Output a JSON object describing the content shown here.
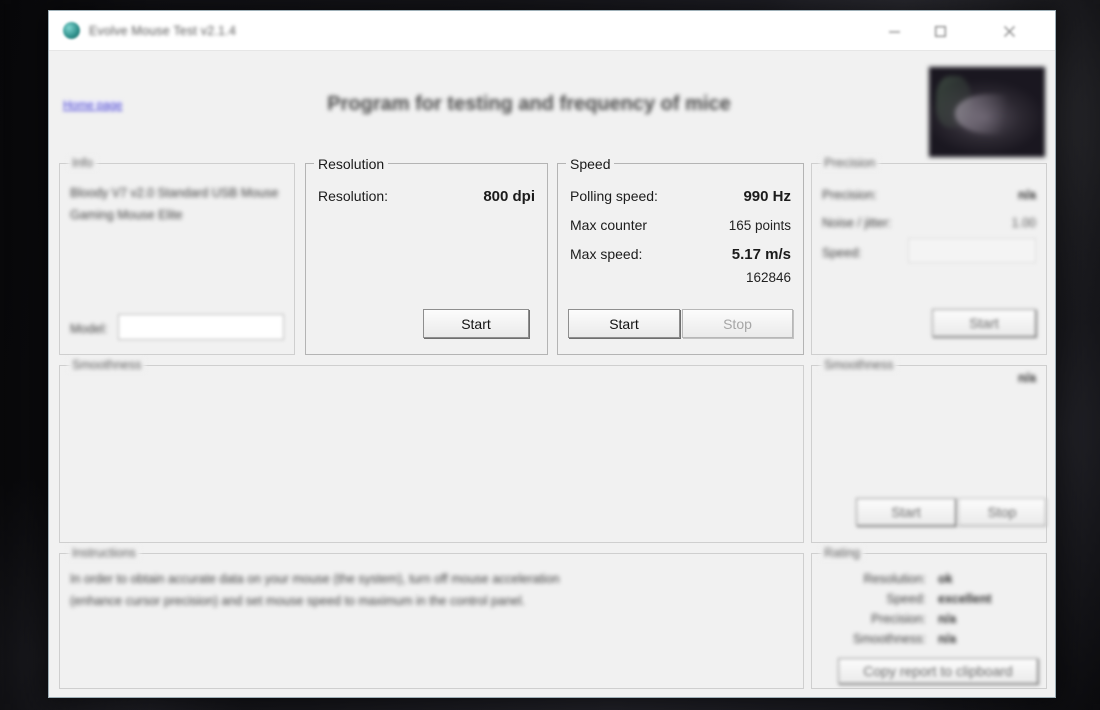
{
  "window": {
    "title": "Evolve Mouse Test v2.1.4",
    "controls": {
      "minimize": "minimize",
      "maximize": "maximize",
      "close": "close"
    }
  },
  "header": {
    "homepage_link": "Home page",
    "heading": "Program for testing and frequency of mice",
    "photo_alt": "mouse-photo"
  },
  "info_group": {
    "legend": "Info",
    "device_line1": "Bloody V7 v2.0 Standard USB Mouse",
    "device_line2": "Gaming Mouse Elite",
    "model_label": "Model:",
    "model_value": ""
  },
  "resolution_group": {
    "legend": "Resolution",
    "resolution_label": "Resolution:",
    "resolution_value": "800 dpi",
    "start_label": "Start"
  },
  "speed_group": {
    "legend": "Speed",
    "polling_label": "Polling speed:",
    "polling_value": "990 Hz",
    "counter_label": "Max counter",
    "counter_value": "165 points",
    "maxspeed_label": "Max  speed:",
    "maxspeed_value": "5.17 m/s",
    "maxspeed_raw": "162846",
    "start_label": "Start",
    "stop_label": "Stop"
  },
  "precision_group": {
    "legend": "Precision",
    "precision_label": "Precision:",
    "precision_value": "n/a",
    "noise_label": "Noise / jitter:",
    "noise_value": "1.00",
    "speed_label": "Speed:",
    "speed_value": "",
    "start_label": "Start"
  },
  "smoothness_left": {
    "legend": "Smoothness"
  },
  "smoothness_right": {
    "legend": "Smoothness",
    "value": "n/a",
    "start_label": "Start",
    "stop_label": "Stop"
  },
  "instructions_group": {
    "legend": "Instructions",
    "line1": "In order to obtain accurate data on your mouse (the system), turn off mouse acceleration",
    "line2": "(enhance cursor precision) and set mouse speed to maximum in the control panel."
  },
  "rating_group": {
    "legend": "Rating",
    "rows": [
      {
        "label": "Resolution:",
        "value": "ok"
      },
      {
        "label": "Speed:",
        "value": "excellent"
      },
      {
        "label": "Precision:",
        "value": "n/a"
      },
      {
        "label": "Smoothness:",
        "value": "n/a"
      }
    ],
    "copy_button": "Copy report to clipboard"
  },
  "colors": {
    "accent_link": "#4b47c9",
    "window_bg": "#f1f1f1",
    "titlebar_bg": "#ffffff",
    "desktop_bg": "#141418"
  }
}
